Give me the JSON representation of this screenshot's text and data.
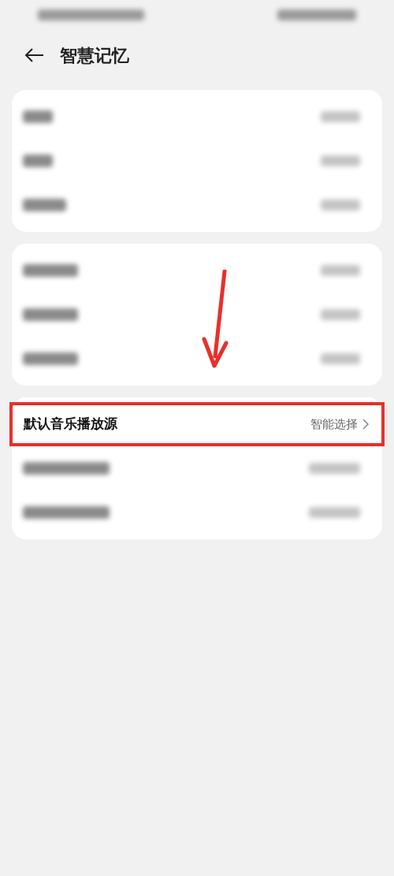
{
  "header": {
    "title": "智慧记忆"
  },
  "groups": [
    {
      "rows": [
        {
          "kind": "blurred"
        },
        {
          "kind": "blurred"
        },
        {
          "kind": "blurred"
        }
      ]
    },
    {
      "rows": [
        {
          "kind": "blurred"
        },
        {
          "kind": "blurred"
        },
        {
          "kind": "blurred"
        }
      ]
    },
    {
      "rows": [
        {
          "kind": "clear",
          "label": "默认音乐播放源",
          "value": "智能选择",
          "highlighted": true
        },
        {
          "kind": "blurred"
        },
        {
          "kind": "blurred"
        }
      ]
    }
  ]
}
